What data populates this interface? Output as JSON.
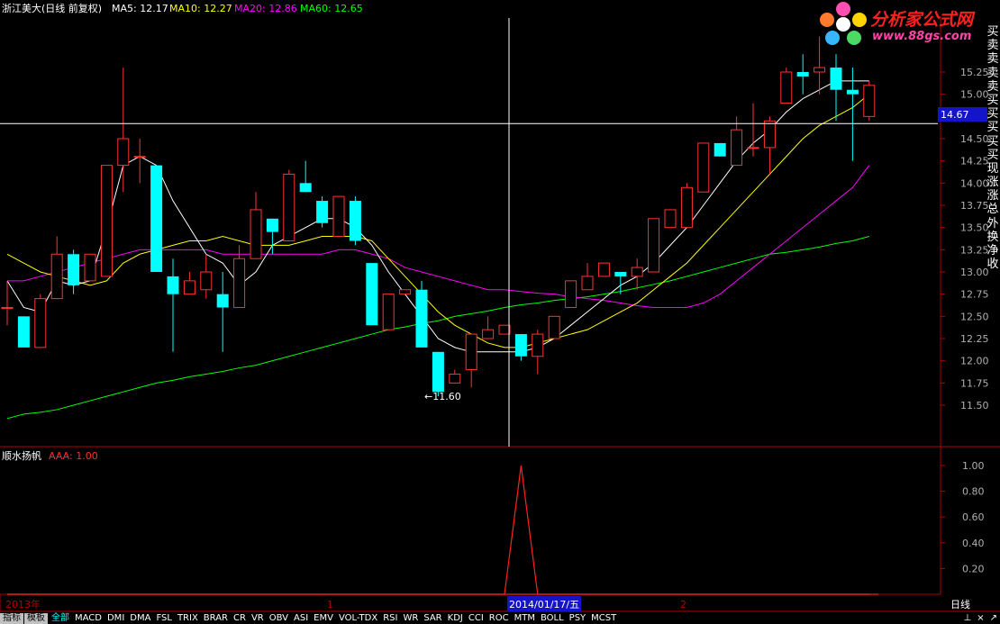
{
  "header": {
    "stock_label": "浙江美大(日线 前复权)",
    "ma5": "MA5: 12.17",
    "ma10": "MA10: 12.27",
    "ma20": "MA20: 12.86",
    "ma60": "MA60: 12.65"
  },
  "indicator": {
    "name": "顺水扬帆",
    "value_label": "AAA: 1.00"
  },
  "crosshair": {
    "price_label": "14.67",
    "date_label": "2014/01/17/五"
  },
  "low_marker": "←11.60",
  "timeline": {
    "year_label": "2013年",
    "m1": "1",
    "m2": "2",
    "period": "日线"
  },
  "right_panel_chars": [
    "买",
    "卖",
    "卖",
    "卖",
    "卖",
    "买",
    "买",
    "买",
    "买",
    "买",
    "现",
    "涨",
    "涨",
    "总",
    "外",
    "换",
    "净",
    "收"
  ],
  "logo": {
    "text": "分析家公式网",
    "url": "www.88gs.com"
  },
  "bottom_tabs": {
    "modes": [
      "指标",
      "模板"
    ],
    "items": [
      "全部",
      "MACD",
      "DMI",
      "DMA",
      "FSL",
      "TRIX",
      "BRAR",
      "CR",
      "VR",
      "OBV",
      "ASI",
      "EMV",
      "VOL-TDX",
      "RSI",
      "WR",
      "SAR",
      "KDJ",
      "CCI",
      "ROC",
      "MTM",
      "BOLL",
      "PSY",
      "MCST"
    ]
  },
  "window_controls": [
    "⊥",
    "×",
    "↗"
  ],
  "colors": {
    "up": "#ff3232",
    "down": "#00ffff",
    "ma5": "#ffffff",
    "ma10": "#ffff00",
    "ma20": "#ff00ff",
    "ma60": "#00ff00",
    "axis": "#b00000",
    "indicator": "#ff2020"
  },
  "chart_data": [
    {
      "type": "candlestick",
      "title": "浙江美大(日线 前复权)",
      "ylim": [
        11.3,
        15.5
      ],
      "y_ticks": [
        11.5,
        11.75,
        12.0,
        12.25,
        12.5,
        12.75,
        13.0,
        13.25,
        13.5,
        13.75,
        14.0,
        14.25,
        14.5,
        14.75,
        15.0,
        15.25
      ],
      "candles": [
        {
          "o": 12.6,
          "h": 12.9,
          "l": 12.4,
          "c": 12.6
        },
        {
          "o": 12.5,
          "h": 12.5,
          "l": 12.15,
          "c": 12.15
        },
        {
          "o": 12.15,
          "h": 12.75,
          "l": 12.15,
          "c": 12.7
        },
        {
          "o": 12.7,
          "h": 13.4,
          "l": 12.7,
          "c": 13.2
        },
        {
          "o": 13.2,
          "h": 13.25,
          "l": 12.75,
          "c": 12.85
        },
        {
          "o": 12.9,
          "h": 13.2,
          "l": 12.9,
          "c": 13.2
        },
        {
          "o": 12.95,
          "h": 14.2,
          "l": 12.95,
          "c": 14.2
        },
        {
          "o": 14.2,
          "h": 15.3,
          "l": 13.9,
          "c": 14.5
        },
        {
          "o": 14.3,
          "h": 14.5,
          "l": 14.0,
          "c": 14.3
        },
        {
          "o": 14.2,
          "h": 14.2,
          "l": 13.0,
          "c": 13.0
        },
        {
          "o": 12.95,
          "h": 13.15,
          "l": 12.1,
          "c": 12.75
        },
        {
          "o": 12.75,
          "h": 13.0,
          "l": 12.75,
          "c": 12.9
        },
        {
          "o": 12.8,
          "h": 13.2,
          "l": 12.7,
          "c": 13.0
        },
        {
          "o": 12.75,
          "h": 13.0,
          "l": 12.1,
          "c": 12.6
        },
        {
          "o": 12.6,
          "h": 13.3,
          "l": 12.6,
          "c": 13.15
        },
        {
          "o": 13.15,
          "h": 13.9,
          "l": 13.15,
          "c": 13.7
        },
        {
          "o": 13.6,
          "h": 13.6,
          "l": 13.2,
          "c": 13.45
        },
        {
          "o": 13.35,
          "h": 14.15,
          "l": 13.35,
          "c": 14.1
        },
        {
          "o": 14.0,
          "h": 14.25,
          "l": 13.9,
          "c": 13.9
        },
        {
          "o": 13.8,
          "h": 13.85,
          "l": 13.5,
          "c": 13.55
        },
        {
          "o": 13.4,
          "h": 13.85,
          "l": 13.4,
          "c": 13.85
        },
        {
          "o": 13.8,
          "h": 13.85,
          "l": 13.3,
          "c": 13.35
        },
        {
          "o": 13.1,
          "h": 13.1,
          "l": 12.4,
          "c": 12.4
        },
        {
          "o": 12.35,
          "h": 12.75,
          "l": 12.35,
          "c": 12.75
        },
        {
          "o": 12.75,
          "h": 12.8,
          "l": 12.75,
          "c": 12.8
        },
        {
          "o": 12.8,
          "h": 12.9,
          "l": 12.15,
          "c": 12.15
        },
        {
          "o": 12.1,
          "h": 12.1,
          "l": 11.6,
          "c": 11.65
        },
        {
          "o": 11.75,
          "h": 11.9,
          "l": 11.75,
          "c": 11.85
        },
        {
          "o": 11.9,
          "h": 12.3,
          "l": 11.7,
          "c": 12.3
        },
        {
          "o": 12.25,
          "h": 12.5,
          "l": 12.25,
          "c": 12.35
        },
        {
          "o": 12.3,
          "h": 12.4,
          "l": 12.3,
          "c": 12.4
        },
        {
          "o": 12.3,
          "h": 12.3,
          "l": 12.0,
          "c": 12.05
        },
        {
          "o": 12.05,
          "h": 12.35,
          "l": 11.85,
          "c": 12.3
        },
        {
          "o": 12.25,
          "h": 12.5,
          "l": 12.25,
          "c": 12.5
        },
        {
          "o": 12.6,
          "h": 12.9,
          "l": 12.6,
          "c": 12.9
        },
        {
          "o": 12.8,
          "h": 13.1,
          "l": 12.8,
          "c": 12.95
        },
        {
          "o": 12.95,
          "h": 13.1,
          "l": 12.95,
          "c": 13.1
        },
        {
          "o": 13.0,
          "h": 13.0,
          "l": 12.75,
          "c": 12.95
        },
        {
          "o": 12.95,
          "h": 13.15,
          "l": 12.8,
          "c": 13.05
        },
        {
          "o": 13.0,
          "h": 13.6,
          "l": 13.0,
          "c": 13.6
        },
        {
          "o": 13.5,
          "h": 13.7,
          "l": 13.5,
          "c": 13.7
        },
        {
          "o": 13.5,
          "h": 14.0,
          "l": 13.5,
          "c": 13.95
        },
        {
          "o": 13.9,
          "h": 14.45,
          "l": 13.9,
          "c": 14.45
        },
        {
          "o": 14.45,
          "h": 14.45,
          "l": 14.3,
          "c": 14.3
        },
        {
          "o": 14.2,
          "h": 14.75,
          "l": 14.2,
          "c": 14.6
        },
        {
          "o": 14.4,
          "h": 14.9,
          "l": 14.3,
          "c": 14.4
        },
        {
          "o": 14.4,
          "h": 14.75,
          "l": 14.1,
          "c": 14.7
        },
        {
          "o": 14.9,
          "h": 15.3,
          "l": 14.9,
          "c": 15.25
        },
        {
          "o": 15.25,
          "h": 15.45,
          "l": 15.0,
          "c": 15.2
        },
        {
          "o": 15.25,
          "h": 15.65,
          "l": 15.0,
          "c": 15.3
        },
        {
          "o": 15.3,
          "h": 15.45,
          "l": 14.7,
          "c": 15.05
        },
        {
          "o": 15.05,
          "h": 15.3,
          "l": 14.25,
          "c": 15.0
        },
        {
          "o": 14.75,
          "h": 15.15,
          "l": 14.7,
          "c": 15.1
        }
      ],
      "ma5": [
        12.9,
        12.6,
        12.55,
        12.9,
        12.85,
        12.9,
        13.5,
        14.2,
        14.3,
        14.2,
        13.8,
        13.5,
        13.2,
        13.1,
        12.85,
        13.0,
        13.3,
        13.4,
        13.5,
        13.6,
        13.6,
        13.5,
        13.3,
        13.0,
        12.75,
        12.5,
        12.25,
        12.15,
        12.1,
        12.1,
        12.1,
        12.1,
        12.15,
        12.25,
        12.4,
        12.55,
        12.7,
        12.85,
        12.95,
        13.1,
        13.3,
        13.5,
        13.75,
        14.0,
        14.25,
        14.45,
        14.6,
        14.8,
        14.95,
        15.05,
        15.15,
        15.15,
        15.15
      ],
      "ma10": [
        13.2,
        13.1,
        13.0,
        12.95,
        12.9,
        12.85,
        12.9,
        13.1,
        13.2,
        13.25,
        13.3,
        13.35,
        13.35,
        13.4,
        13.35,
        13.3,
        13.3,
        13.3,
        13.35,
        13.4,
        13.4,
        13.4,
        13.35,
        13.15,
        12.95,
        12.75,
        12.55,
        12.4,
        12.3,
        12.2,
        12.15,
        12.15,
        12.2,
        12.25,
        12.3,
        12.35,
        12.45,
        12.55,
        12.65,
        12.8,
        12.95,
        13.1,
        13.3,
        13.5,
        13.7,
        13.9,
        14.1,
        14.3,
        14.5,
        14.65,
        14.75,
        14.85,
        15.0
      ],
      "ma20": [
        12.9,
        12.9,
        12.95,
        13.0,
        13.05,
        13.1,
        13.15,
        13.2,
        13.25,
        13.25,
        13.25,
        13.25,
        13.25,
        13.2,
        13.2,
        13.2,
        13.2,
        13.2,
        13.2,
        13.2,
        13.25,
        13.25,
        13.2,
        13.15,
        13.05,
        13.0,
        12.95,
        12.9,
        12.85,
        12.8,
        12.8,
        12.78,
        12.76,
        12.75,
        12.72,
        12.7,
        12.68,
        12.65,
        12.62,
        12.6,
        12.6,
        12.6,
        12.65,
        12.75,
        12.9,
        13.05,
        13.2,
        13.35,
        13.5,
        13.65,
        13.8,
        13.95,
        14.2
      ],
      "ma60": [
        11.35,
        11.4,
        11.42,
        11.45,
        11.5,
        11.55,
        11.6,
        11.65,
        11.7,
        11.75,
        11.78,
        11.82,
        11.85,
        11.88,
        11.92,
        11.95,
        12.0,
        12.05,
        12.1,
        12.15,
        12.2,
        12.25,
        12.3,
        12.35,
        12.38,
        12.42,
        12.45,
        12.5,
        12.53,
        12.56,
        12.6,
        12.63,
        12.65,
        12.68,
        12.7,
        12.72,
        12.75,
        12.78,
        12.82,
        12.86,
        12.9,
        12.95,
        13.0,
        13.05,
        13.1,
        13.15,
        13.2,
        13.22,
        13.25,
        13.28,
        13.32,
        13.35,
        13.4
      ]
    },
    {
      "type": "line",
      "title": "顺水扬帆",
      "series": [
        {
          "name": "AAA",
          "values": [
            0,
            0,
            0,
            0,
            0,
            0,
            0,
            0,
            0,
            0,
            0,
            0,
            0,
            0,
            0,
            0,
            0,
            0,
            0,
            0,
            0,
            0,
            0,
            0,
            0,
            0,
            0,
            0,
            0,
            0,
            0,
            1,
            0,
            0,
            0,
            0,
            0,
            0,
            0,
            0,
            0,
            0,
            0,
            0,
            0,
            0,
            0,
            0,
            0,
            0,
            0,
            0,
            0
          ]
        }
      ],
      "ylim": [
        0,
        1.1
      ],
      "y_ticks": [
        0.2,
        0.4,
        0.6,
        0.8,
        1.0
      ]
    }
  ]
}
